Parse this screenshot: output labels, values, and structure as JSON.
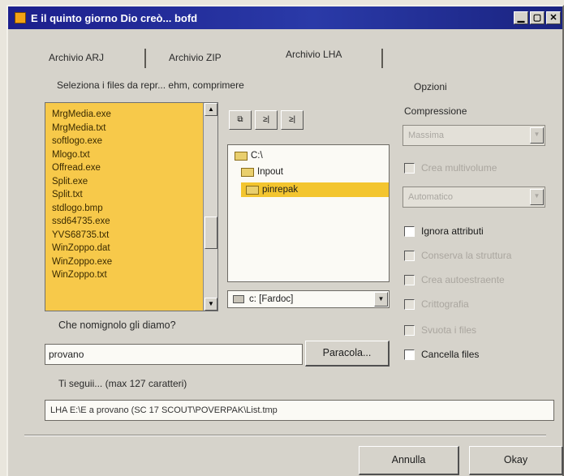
{
  "window": {
    "title": "E il quinto giorno Dio creò... bofd",
    "controls": [
      "▁",
      "▢",
      "✕"
    ]
  },
  "tabs": [
    {
      "label": "Archivio ARJ"
    },
    {
      "label": "Archivio ZIP"
    },
    {
      "label": "Archivio LHA"
    }
  ],
  "files_group_label": "Seleziona i files da repr... ehm, comprimere",
  "files": [
    "MrgMedia.exe",
    "MrgMedia.txt",
    "softlogo.exe",
    "Mlogo.txt",
    "Offread.exe",
    "Split.exe",
    "Split.txt",
    "stdlogo.bmp",
    "ssd64735.exe",
    "YVS68735.txt",
    "WinZoppo.dat",
    "WinZoppo.exe",
    "WinZoppo.txt"
  ],
  "toolbar": {
    "btn1": "⧉",
    "btn2": "≥|",
    "btn3": "≥|"
  },
  "dirs": [
    {
      "label": "C:\\"
    },
    {
      "label": "Inpout"
    },
    {
      "label": "pinrepak"
    }
  ],
  "drive_label": "c: [Fardoc]",
  "options": {
    "label": "Opzioni",
    "compression_label": "Compressione",
    "compression_value": "Massima",
    "multivol_label": "Crea multivolume",
    "volume_size": "Automatico",
    "checkboxes": [
      {
        "label": "Ignora attributi",
        "enabled": true
      },
      {
        "label": "Conserva la struttura",
        "enabled": false
      },
      {
        "label": "Crea autoestraente",
        "enabled": false
      },
      {
        "label": "Crittografia",
        "enabled": false
      },
      {
        "label": "Svuota i files",
        "enabled": false
      },
      {
        "label": "Cancella files",
        "enabled": true
      }
    ]
  },
  "name_prompt": "Che nomignolo gli diamo?",
  "name_value": "provano",
  "browse_label": "Paracola...",
  "cmd_label": "Ti seguii... (max 127 caratteri)",
  "cmd_value": "LHA E:\\E a provano (SC 17 SCOUT\\POVERPAK\\List.tmp",
  "cancel_label": "Annulla",
  "ok_label": "Okay"
}
